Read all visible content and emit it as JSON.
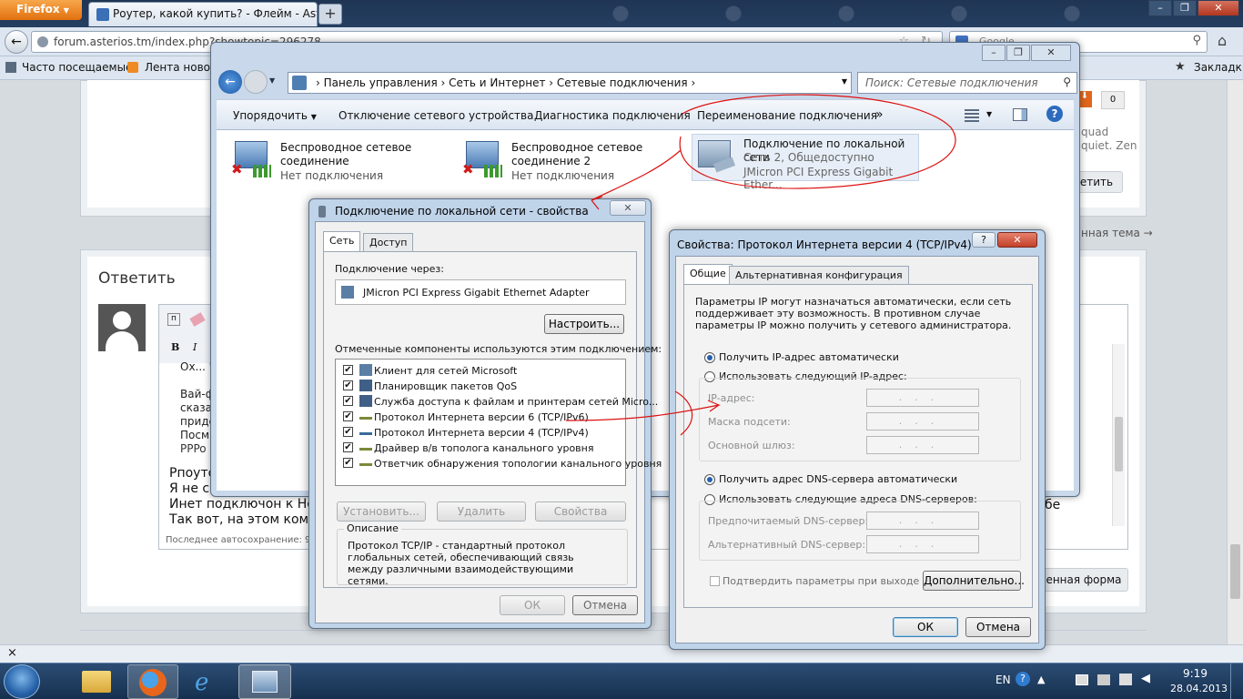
{
  "firefox": {
    "menu_label": "Firefox",
    "tab_title": "Роутер, какой купить? - Флейм - Asterios",
    "new_tab": "+",
    "url": "forum.asterios.tm/index.php?showtopic=296278",
    "search_placeholder": "Google",
    "bookmarks": {
      "most_visited": "Часто посещаемые",
      "news_feed": "Лента новост",
      "all_bookmarks": "Закладки"
    }
  },
  "forum": {
    "text_fragments": [
      "quad",
      "quiet. Zen",
      "етить",
      "нная тема →"
    ],
    "reply_heading": "Ответить",
    "vote_count": "0",
    "editor_lines": [
      "Ох... Ч",
      "Вай-ф",
      "сказа",
      "приде",
      "Посм",
      "PPPo"
    ],
    "body_lines": [
      "Рпоуто",
      "Я не с",
      "Инет подключон к Ноут",
      "Так вот, на этом компе"
    ],
    "autosave": "Последнее автосохранение: 9",
    "full_form_btn": "енная форма",
    "body_suffix": "бе"
  },
  "explorer": {
    "breadcrumbs": [
      "Панель управления",
      "Сеть и Интернет",
      "Сетевые подключения"
    ],
    "search_placeholder": "Поиск: Сетевые подключения",
    "toolbar": {
      "organize": "Упорядочить",
      "disable": "Отключение сетевого устройства",
      "diagnose": "Диагностика подключения",
      "rename": "Переименование подключения",
      "more": "»"
    },
    "connections": [
      {
        "name": "Беспроводное сетевое соединение",
        "status": "Нет подключения"
      },
      {
        "name": "Беспроводное сетевое соединение 2",
        "status": "Нет подключения"
      },
      {
        "name": "Подключение по локальной сети",
        "status": "Сеть  2, Общедоступно",
        "device": "JMicron PCI Express Gigabit Ether..."
      }
    ]
  },
  "lan_dialog": {
    "title": "Подключение по локальной сети - свойства",
    "tabs": [
      "Сеть",
      "Доступ"
    ],
    "connect_using_label": "Подключение через:",
    "adapter": "JMicron PCI Express Gigabit Ethernet Adapter",
    "configure_btn": "Настроить...",
    "components_label": "Отмеченные компоненты используются этим подключением:",
    "components": [
      "Клиент для сетей Microsoft",
      "Планировщик пакетов QoS",
      "Служба доступа к файлам и принтерам сетей Micro...",
      "Протокол Интернета версии 6 (TCP/IPv6)",
      "Протокол Интернета версии 4 (TCP/IPv4)",
      "Драйвер в/в тополога канального уровня",
      "Ответчик обнаружения топологии канального уровня"
    ],
    "install_btn": "Установить...",
    "remove_btn": "Удалить",
    "properties_btn": "Свойства",
    "description_label": "Описание",
    "description": "Протокол TCP/IP - стандартный протокол глобальных сетей, обеспечивающий связь между различными взаимодействующими сетями.",
    "ok": "ОК",
    "cancel": "Отмена"
  },
  "ipv4_dialog": {
    "title": "Свойства: Протокол Интернета версии 4 (TCP/IPv4)",
    "help": "?",
    "tabs": [
      "Общие",
      "Альтернативная конфигурация"
    ],
    "intro": "Параметры IP могут назначаться автоматически, если сеть поддерживает эту возможность. В противном случае параметры IP можно получить у сетевого администратора.",
    "auto_ip": "Получить IP-адрес автоматически",
    "manual_ip": "Использовать следующий IP-адрес:",
    "ip_label": "IP-адрес:",
    "mask_label": "Маска подсети:",
    "gateway_label": "Основной шлюз:",
    "auto_dns": "Получить адрес DNS-сервера автоматически",
    "manual_dns": "Использовать следующие адреса DNS-серверов:",
    "pref_dns_label": "Предпочитаемый DNS-сервер:",
    "alt_dns_label": "Альтернативный DNS-сервер:",
    "ip_placeholder": "...",
    "validate": "Подтвердить параметры при выходе",
    "advanced_btn": "Дополнительно...",
    "ok": "ОК",
    "cancel": "Отмена"
  },
  "status_close": "×",
  "tray": {
    "lang": "EN",
    "time": "9:19",
    "date": "28.04.2013"
  }
}
